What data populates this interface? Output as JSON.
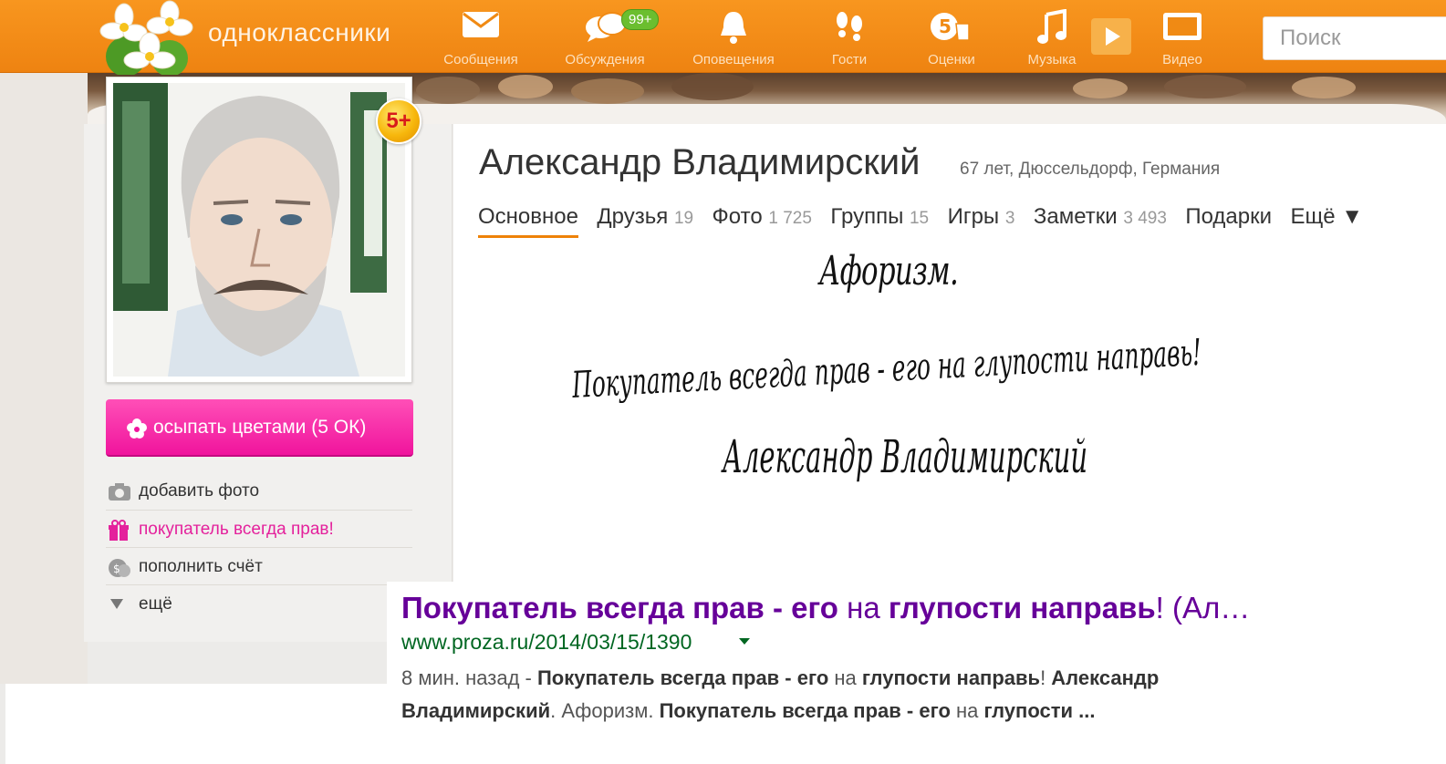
{
  "topbar": {
    "logo_text": "одноклассники",
    "nav": [
      {
        "label": "Сообщения",
        "icon": "envelope-icon"
      },
      {
        "label": "Обсуждения",
        "icon": "speech-bubbles-icon",
        "badge": "99+"
      },
      {
        "label": "Оповещения",
        "icon": "bell-icon"
      },
      {
        "label": "Гости",
        "icon": "footprints-icon"
      },
      {
        "label": "Оценки",
        "icon": "rating-five-icon"
      },
      {
        "label": "Музыка",
        "icon": "music-note-icon"
      },
      {
        "label": "Видео",
        "icon": "video-icon"
      }
    ],
    "search_placeholder": "Поиск",
    "colors": {
      "bar": "#f28a18",
      "badge": "#6bbe2f"
    }
  },
  "profile": {
    "name": "Александр Владимирский",
    "meta": "67 лет, Дюссельдорф, Германия",
    "badge": "5+",
    "tabs": [
      {
        "label": "Основное",
        "count": ""
      },
      {
        "label": "Друзья",
        "count": "19"
      },
      {
        "label": "Фото",
        "count": "1 725"
      },
      {
        "label": "Группы",
        "count": "15"
      },
      {
        "label": "Игры",
        "count": "3"
      },
      {
        "label": "Заметки",
        "count": "3 493"
      },
      {
        "label": "Подарки",
        "count": ""
      },
      {
        "label": "Ещё ▼",
        "count": ""
      }
    ],
    "active_tab": "Основное"
  },
  "sidebar": {
    "flowers_button": "осыпать цветами (5 ОК)",
    "items": [
      {
        "label": "добавить фото",
        "icon": "camera-icon"
      },
      {
        "label": "покупатель всегда прав!",
        "icon": "gift-icon"
      },
      {
        "label": "пополнить счёт",
        "icon": "coins-icon"
      },
      {
        "label": "ещё",
        "icon": "triangle-down-icon"
      }
    ],
    "accent": "#f0149d"
  },
  "aphorism": {
    "title": "Афоризм.",
    "text": "Покупатель всегда прав - его на глупости направь!",
    "author": "Александр Владимирский"
  },
  "search_result": {
    "title_parts": [
      {
        "t": "Покупатель всегда прав - его",
        "b": true
      },
      {
        "t": " на ",
        "b": false
      },
      {
        "t": "глупости направь",
        "b": true
      },
      {
        "t": "! (Ал…",
        "b": false
      }
    ],
    "url": "www.proza.ru/2014/03/15/1390",
    "snippet_parts": [
      {
        "t": "8 мин. назад - ",
        "b": false
      },
      {
        "t": "Покупатель всегда прав - его",
        "b": true
      },
      {
        "t": " на ",
        "b": false
      },
      {
        "t": "глупости направь",
        "b": true
      },
      {
        "t": "! ",
        "b": false
      },
      {
        "t": "Александр Владимирский",
        "b": true
      },
      {
        "t": ". Афоризм. ",
        "b": false
      },
      {
        "t": "Покупатель всегда прав - его",
        "b": true
      },
      {
        "t": " на ",
        "b": false
      },
      {
        "t": "глупости ...",
        "b": true
      }
    ]
  }
}
